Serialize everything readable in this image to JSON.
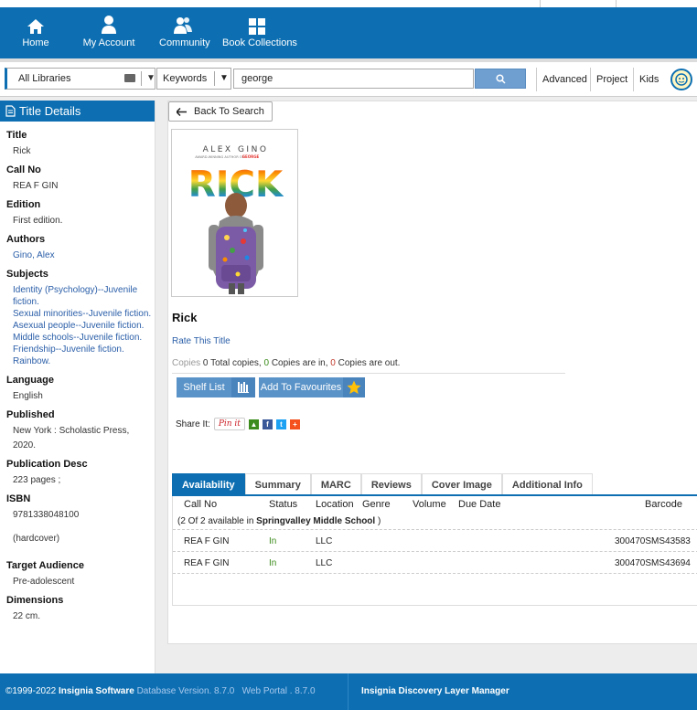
{
  "nav": {
    "home": "Home",
    "account": "My Account",
    "community": "Community",
    "collections": "Book Collections"
  },
  "search": {
    "library": "All Libraries",
    "field": "Keywords",
    "query": "george",
    "advanced": "Advanced",
    "project": "Project",
    "kids": "Kids"
  },
  "sidebar": {
    "heading": "Title Details",
    "title_label": "Title",
    "title": "Rick",
    "callno_label": "Call No",
    "callno": "REA F GIN",
    "edition_label": "Edition",
    "edition": "First edition.",
    "authors_label": "Authors",
    "author": "Gino, Alex",
    "subjects_label": "Subjects",
    "subjects": [
      "Identity (Psychology)--Juvenile",
      "fiction.",
      "Sexual minorities--Juvenile fiction.",
      "Asexual people--Juvenile fiction.",
      "Middle schools--Juvenile fiction.",
      "Friendship--Juvenile fiction.",
      "Rainbow."
    ],
    "language_label": "Language",
    "language": "English",
    "published_label": "Published",
    "published_1": "New York : Scholastic Press,",
    "published_2": "2020.",
    "pubdesc_label": "Publication Desc",
    "pubdesc": "223 pages ;",
    "isbn_label": "ISBN",
    "isbn": "9781338048100",
    "isbn_note": "(hardcover)",
    "audience_label": "Target Audience",
    "audience": "Pre-adolescent",
    "dimensions_label": "Dimensions",
    "dimensions": "22 cm."
  },
  "main": {
    "back": "Back To Search",
    "cover_author": "ALEX GINO",
    "cover_tagline": "AWARD-WINNING AUTHOR OF",
    "cover_tagline_book": "GEORGE",
    "cover_title": "RICK",
    "title": "Rick",
    "rate": "Rate This Title",
    "copies_label": "Copies",
    "copies_total": "0",
    "copies_total_text": "Total copies,",
    "copies_in": "0",
    "copies_in_text": "Copies are in,",
    "copies_out": "0",
    "copies_out_text": "Copies are out.",
    "shelf_list": "Shelf List",
    "add_fav": "Add To Favourites",
    "share": "Share It:",
    "pinit": "Pin it"
  },
  "tabs": [
    "Availability",
    "Summary",
    "MARC",
    "Reviews",
    "Cover Image",
    "Additional Info"
  ],
  "table": {
    "headers": [
      "Call No",
      "Status",
      "Location",
      "Genre",
      "Volume",
      "Due Date",
      "Barcode"
    ],
    "note_pre": "(2 Of 2 available in",
    "note_school": "Springvalley Middle School",
    "note_post": ")",
    "rows": [
      {
        "callno": "REA F GIN",
        "status": "In",
        "location": "LLC",
        "barcode": "300470SMS43583"
      },
      {
        "callno": "REA F GIN",
        "status": "In",
        "location": "LLC",
        "barcode": "300470SMS43694"
      }
    ]
  },
  "footer": {
    "copyright": "©1999-2022",
    "company": "Insignia Software",
    "db": "Database Version. 8.7.0",
    "portal": "Web Portal . 8.7.0",
    "right": "Insignia Discovery Layer Manager"
  },
  "colors": {
    "primary": "#0d6fb2",
    "button": "#5a93c8",
    "status_in": "#3b8c1c",
    "link": "#2a5ea8"
  }
}
